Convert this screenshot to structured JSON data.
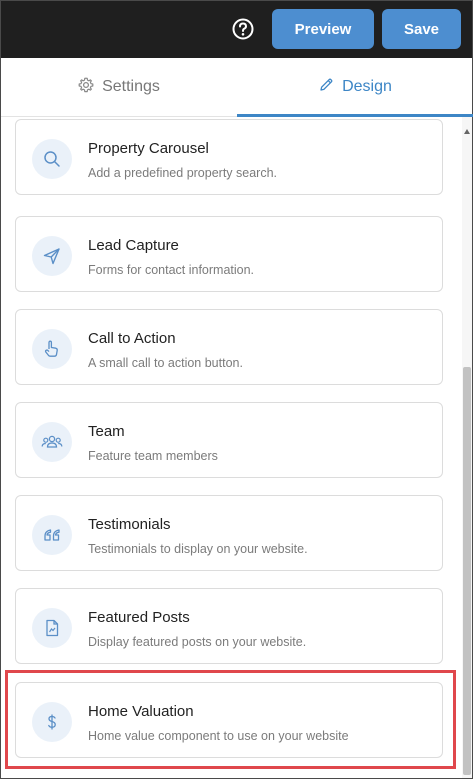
{
  "header": {
    "help_icon": "question-circle-icon",
    "preview_label": "Preview",
    "save_label": "Save",
    "accent_color": "#4d8ed0"
  },
  "tabs": [
    {
      "label": "Settings",
      "icon": "gear-icon",
      "active": false
    },
    {
      "label": "Design",
      "icon": "pencil-icon",
      "active": true
    }
  ],
  "components": [
    {
      "title": "Property Carousel",
      "description": "Add a predefined property search.",
      "icon": "search-icon"
    },
    {
      "title": "Lead Capture",
      "description": "Forms for contact information.",
      "icon": "send-icon"
    },
    {
      "title": "Call to Action",
      "description": "A small call to action button.",
      "icon": "pointer-hand-icon"
    },
    {
      "title": "Team",
      "description": "Feature team members",
      "icon": "users-icon"
    },
    {
      "title": "Testimonials",
      "description": "Testimonials to display on your website.",
      "icon": "quote-icon"
    },
    {
      "title": "Featured Posts",
      "description": "Display featured posts on your website.",
      "icon": "document-icon"
    },
    {
      "title": "Home Valuation",
      "description": "Home value component to use on your website",
      "icon": "dollar-icon",
      "highlighted": true
    }
  ],
  "highlight_color": "#e0474c"
}
